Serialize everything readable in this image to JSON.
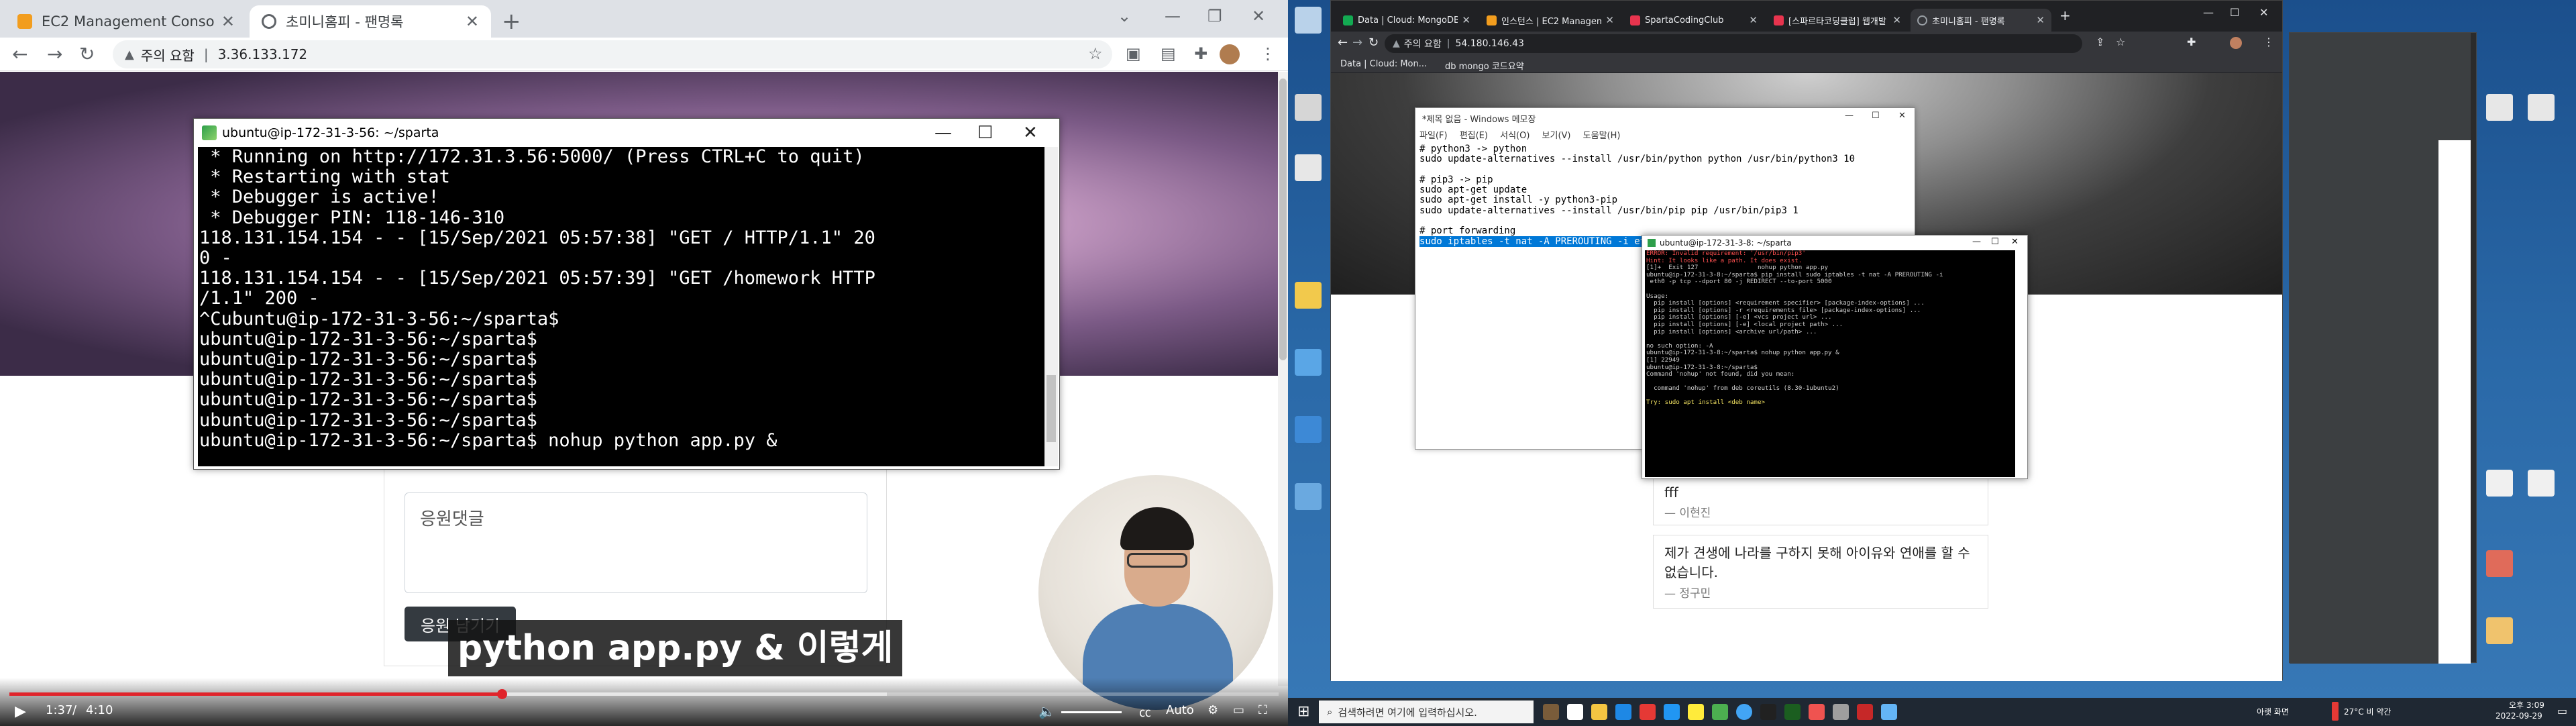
{
  "left": {
    "tabs": [
      {
        "title": "EC2 Management Console",
        "color": "#f29d1e"
      },
      {
        "title": "초미니홈피 - 팬명록",
        "color": "#5f6368"
      }
    ],
    "address": {
      "warning": "주의 요함",
      "url": "3.36.133.172"
    },
    "terminal": {
      "title": "ubuntu@ip-172-31-3-56: ~/sparta",
      "lines": [
        " * Running on http://172.31.3.56:5000/ (Press CTRL+C to quit)",
        " * Restarting with stat",
        " * Debugger is active!",
        " * Debugger PIN: 118-146-310",
        "118.131.154.154 - - [15/Sep/2021 05:57:38] \"GET / HTTP/1.1\" 20",
        "0 -",
        "118.131.154.154 - - [15/Sep/2021 05:57:39] \"GET /homework HTTP",
        "/1.1\" 200 -",
        "^Cubuntu@ip-172-31-3-56:~/sparta$",
        "ubuntu@ip-172-31-3-56:~/sparta$",
        "ubuntu@ip-172-31-3-56:~/sparta$",
        "ubuntu@ip-172-31-3-56:~/sparta$",
        "ubuntu@ip-172-31-3-56:~/sparta$",
        "ubuntu@ip-172-31-3-56:~/sparta$",
        "ubuntu@ip-172-31-3-56:~/sparta$ nohup python app.py &"
      ]
    },
    "comment_placeholder": "응원댓글",
    "submit_label": "응원 남기기",
    "subtitle": "python app.py & 이렇게",
    "video": {
      "current": "1:37",
      "duration": "4:10",
      "quality": "Auto",
      "progress": 0.388
    }
  },
  "right": {
    "tabs": [
      {
        "title": "Data | Cloud: MongoDB Clo",
        "color": "#13aa52"
      },
      {
        "title": "인스턴스 | EC2 Managem",
        "color": "#f29d1e"
      },
      {
        "title": "SpartaCodingClub",
        "color": "#e8344e"
      },
      {
        "title": "[스파르타코딩클럽] 웹개발",
        "color": "#e8344e"
      },
      {
        "title": "초미니홈피 - 팬명록",
        "color": "#9aa0a6"
      }
    ],
    "address": {
      "warning": "주의 요함",
      "url": "54.180.146.43"
    },
    "bookmarks": [
      "Data | Cloud: Mon...",
      "db mongo 코드요약"
    ],
    "notepad": {
      "title": "*제목 없음 - Windows 메모장",
      "menu": [
        "파일(F)",
        "편집(E)",
        "서식(O)",
        "보기(V)",
        "도움말(H)"
      ],
      "lines": [
        "# python3 -> python",
        "sudo update-alternatives --install /usr/bin/python python /usr/bin/python3 10",
        "",
        "# pip3 -> pip",
        "sudo apt-get update",
        "sudo apt-get install -y python3-pip",
        "sudo update-alternatives --install /usr/bin/pip pip /usr/bin/pip3 1",
        "",
        "# port forwarding"
      ],
      "highlight": "sudo iptables -t nat -A PREROUTING -i eth0 -p tcp --dport 80 -j REDIRECT --to-port 5000"
    },
    "terminal": {
      "title": "ubuntu@ip-172-31-3-8: ~/sparta",
      "error_lines": [
        "ERROR: Invalid requirement: '/usr/bin/pip3'",
        "Hint: It looks like a path. It does exist."
      ],
      "lines": [
        "[1]+  Exit 127                nohup python app.py",
        "ubuntu@ip-172-31-3-8:~/sparta$ pip install sudo iptables -t nat -A PREROUTING -i",
        " eth0 -p tcp --dport 80 -j REDIRECT --to-port 5000",
        "",
        "Usage:",
        "  pip install [options] <requirement specifier> [package-index-options] ...",
        "  pip install [options] -r <requirements file> [package-index-options] ...",
        "  pip install [options] [-e] <vcs project url> ...",
        "  pip install [options] [-e] <local project path> ...",
        "  pip install [options] <archive url/path> ...",
        "",
        "no such option: -A",
        "ubuntu@ip-172-31-3-8:~/sparta$ nohup python app.py &",
        "[1] 22949",
        "ubuntu@ip-172-31-3-8:~/sparta$",
        "Command 'nohup' not found, did you mean:",
        "",
        "  command 'nohup' from deb coreutils (8.30-1ubuntu2)",
        ""
      ],
      "last_line": "Try: sudo apt install <deb name>"
    },
    "guestbook": [
      {
        "comment": "fff",
        "author": "— 이현진"
      },
      {
        "comment": "제가 견생에 나라를 구하지 못해 아이유와 연애를 할 수 없습니다.",
        "author": "— 정구민"
      }
    ],
    "taskbar": {
      "search_placeholder": "검색하려면 여기에 입력하십시오.",
      "weather": "27°C 비 약간",
      "time": "오후 3:09",
      "date": "2022-09-29",
      "tray_label": "아랫 화면"
    }
  }
}
